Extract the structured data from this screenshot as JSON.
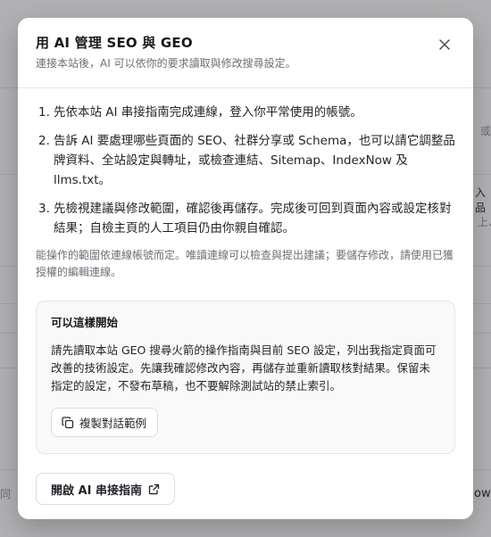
{
  "background": {
    "fragment_1": "或",
    "fragment_2": "入品",
    "fragment_3": "上、",
    "fragment_4": "同",
    "fragment_5": "ow"
  },
  "modal": {
    "title": "用 AI 管理 SEO 與 GEO",
    "subtitle": "連接本站後，AI 可以依你的要求讀取與修改搜尋設定。",
    "close_icon": "close-icon",
    "steps": [
      {
        "num": "1.",
        "text": "先依本站 AI 串接指南完成連線，登入你平常使用的帳號。"
      },
      {
        "num": "2.",
        "text": "告訴 AI 要處理哪些頁面的 SEO、社群分享或 Schema，也可以請它調整品牌資料、全站設定與轉址，或檢查連結、Sitemap、IndexNow 及 llms.txt。"
      },
      {
        "num": "3.",
        "text": "先檢視建議與修改範圍，確認後再儲存。完成後可回到頁面內容或設定核對結果；自檢主頁的人工項目仍由你親自確認。"
      }
    ],
    "note": "能操作的範圍依連線帳號而定。唯讀連線可以檢查與提出建議；要儲存修改，請使用已獲授權的編輯連線。",
    "starter": {
      "title": "可以這樣開始",
      "text": "請先讀取本站 GEO 搜尋火箭的操作指南與目前 SEO 設定，列出我指定頁面可改善的技術設定。先讓我確認修改內容，再儲存並重新讀取核對結果。保留未指定的設定，不發布草稿，也不要解除測試站的禁止索引。",
      "copy_label": "複製對話範例",
      "copy_icon": "copy-icon"
    },
    "guide_label": "開啟 AI 串接指南",
    "guide_icon": "external-link-icon"
  }
}
